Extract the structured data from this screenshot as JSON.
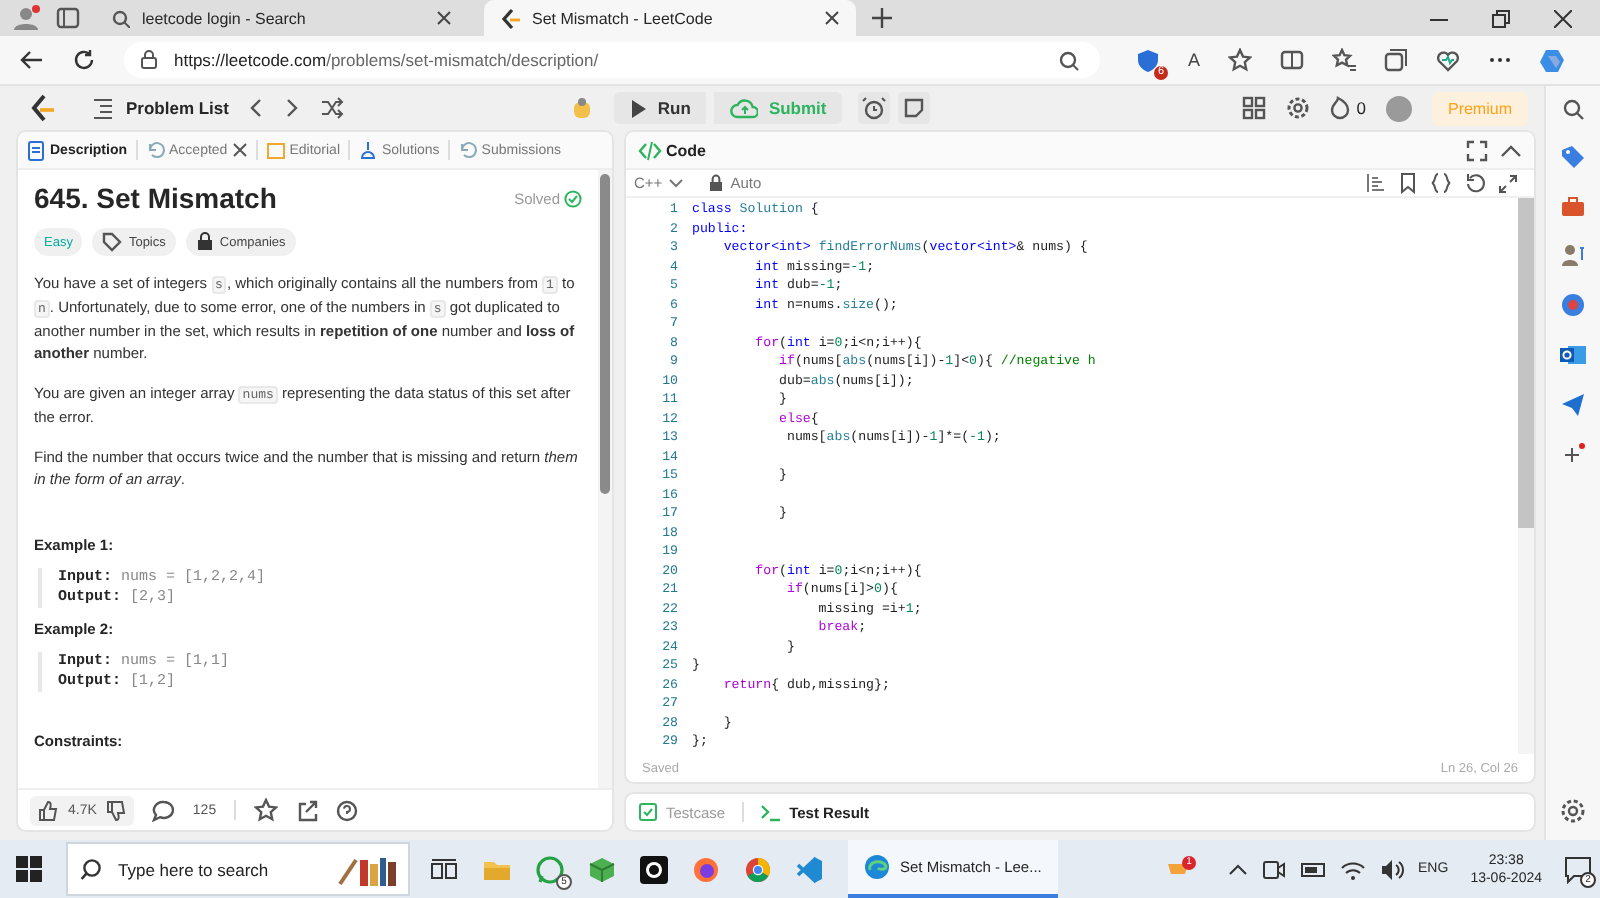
{
  "browser": {
    "tabs": [
      {
        "title": "leetcode login - Search",
        "selected": false
      },
      {
        "title": "Set Mismatch - LeetCode",
        "selected": true
      }
    ],
    "url_host": "https://leetcode.com",
    "url_path": "/problems/set-mismatch/description/",
    "extension_badge": "6",
    "read_aloud": "A"
  },
  "toolbar": {
    "problem_list": "Problem List",
    "run": "Run",
    "submit": "Submit",
    "streak": "0",
    "premium": "Premium"
  },
  "description_panel": {
    "tabs": [
      {
        "label": "Description",
        "selected": true,
        "closable": false
      },
      {
        "label": "Accepted",
        "selected": false,
        "closable": true
      },
      {
        "label": "Editorial",
        "selected": false,
        "closable": false
      },
      {
        "label": "Solutions",
        "selected": false,
        "closable": false
      },
      {
        "label": "Submissions",
        "selected": false,
        "closable": false
      }
    ],
    "title": "645. Set Mismatch",
    "status": "Solved",
    "tags": [
      {
        "label": "Easy",
        "kind": "difficulty"
      },
      {
        "label": "Topics",
        "kind": "topic"
      },
      {
        "label": "Companies",
        "kind": "company"
      }
    ],
    "paragraphs": [
      [
        {
          "kind": "text",
          "text": "You have a set of integers "
        },
        {
          "kind": "code",
          "text": "s"
        },
        {
          "kind": "text",
          "text": ", which originally contains all the numbers from "
        },
        {
          "kind": "code",
          "text": "1"
        },
        {
          "kind": "text",
          "text": " to "
        },
        {
          "kind": "code",
          "text": "n"
        },
        {
          "kind": "text",
          "text": ". Unfortunately, due to some error, one of the numbers in "
        },
        {
          "kind": "code",
          "text": "s"
        },
        {
          "kind": "text",
          "text": " got duplicated to another number in the set, which results in **repetition of one** number and **loss of another** number."
        }
      ],
      [
        {
          "kind": "text",
          "text": "You are given an integer array "
        },
        {
          "kind": "code",
          "text": "nums"
        },
        {
          "kind": "text",
          "text": " representing the data status of this set after the error."
        }
      ],
      [
        {
          "kind": "text",
          "text": "Find the number that occurs twice and the number that is missing and return *them in the form of an array*."
        }
      ]
    ],
    "examples": [
      {
        "heading": "Example 1:",
        "lines": [
          {
            "label": "Input:",
            "value": "nums = [1,2,2,4]"
          },
          {
            "label": "Output:",
            "value": "[2,3]"
          }
        ]
      },
      {
        "heading": "Example 2:",
        "lines": [
          {
            "label": "Input:",
            "value": "nums = [1,1]"
          },
          {
            "label": "Output:",
            "value": "[1,2]"
          }
        ]
      }
    ],
    "constraints_heading": "Constraints:",
    "likes": "4.7K",
    "comments": "125"
  },
  "code_panel": {
    "title": "Code",
    "language": "C++",
    "mode": "Auto",
    "lines": [
      {
        "number": "1",
        "tokens": [
          {
            "kind": "kw",
            "text": "class"
          },
          {
            "kind": "fn",
            "text": " Solution"
          },
          {
            "kind": "tx",
            "text": " {"
          }
        ]
      },
      {
        "number": "2",
        "tokens": [
          {
            "kind": "kw",
            "text": "public:"
          }
        ]
      },
      {
        "number": "3",
        "tokens": [
          {
            "kind": "kw",
            "text": "    vector<int>"
          },
          {
            "kind": "fn",
            "text": " findErrorNums"
          },
          {
            "kind": "tx",
            "text": "("
          },
          {
            "kind": "kw",
            "text": "vector<int>"
          },
          {
            "kind": "tx",
            "text": "& nums) {"
          }
        ]
      },
      {
        "number": "4",
        "tokens": [
          {
            "kind": "kw",
            "text": "        int"
          },
          {
            "kind": "tx",
            "text": " missing="
          },
          {
            "kind": "num",
            "text": "-1"
          },
          {
            "kind": "tx",
            "text": ";"
          }
        ]
      },
      {
        "number": "5",
        "tokens": [
          {
            "kind": "kw",
            "text": "        int"
          },
          {
            "kind": "tx",
            "text": " dub="
          },
          {
            "kind": "num",
            "text": "-1"
          },
          {
            "kind": "tx",
            "text": ";"
          }
        ]
      },
      {
        "number": "6",
        "tokens": [
          {
            "kind": "kw",
            "text": "        int"
          },
          {
            "kind": "tx",
            "text": " n=nums."
          },
          {
            "kind": "fn",
            "text": "size"
          },
          {
            "kind": "tx",
            "text": "();"
          }
        ]
      },
      {
        "number": "7"
      },
      {
        "number": "8",
        "tokens": [
          {
            "kind": "ctl",
            "text": "        for"
          },
          {
            "kind": "tx",
            "text": "("
          },
          {
            "kind": "kw",
            "text": "int"
          },
          {
            "kind": "tx",
            "text": " i="
          },
          {
            "kind": "num",
            "text": "0"
          },
          {
            "kind": "tx",
            "text": ";i<n;i++){"
          }
        ]
      },
      {
        "number": "9",
        "tokens": [
          {
            "kind": "ctl",
            "text": "           if"
          },
          {
            "kind": "tx",
            "text": "(nums["
          },
          {
            "kind": "fn",
            "text": "abs"
          },
          {
            "kind": "tx",
            "text": "(nums[i])-"
          },
          {
            "kind": "num",
            "text": "1"
          },
          {
            "kind": "tx",
            "text": "]<"
          },
          {
            "kind": "num",
            "text": "0"
          },
          {
            "kind": "tx",
            "text": "){ "
          },
          {
            "kind": "cm",
            "text": "//negative h"
          }
        ]
      },
      {
        "number": "10",
        "tokens": [
          {
            "kind": "tx",
            "text": "           dub="
          },
          {
            "kind": "fn",
            "text": "abs"
          },
          {
            "kind": "tx",
            "text": "(nums[i]);"
          }
        ]
      },
      {
        "number": "11",
        "tokens": [
          {
            "kind": "tx",
            "text": "           }"
          }
        ]
      },
      {
        "number": "12",
        "tokens": [
          {
            "kind": "ctl",
            "text": "           else"
          },
          {
            "kind": "tx",
            "text": "{"
          }
        ]
      },
      {
        "number": "13",
        "tokens": [
          {
            "kind": "tx",
            "text": "            nums["
          },
          {
            "kind": "fn",
            "text": "abs"
          },
          {
            "kind": "tx",
            "text": "(nums[i])-"
          },
          {
            "kind": "num",
            "text": "1"
          },
          {
            "kind": "tx",
            "text": "]*=("
          },
          {
            "kind": "num",
            "text": "-1"
          },
          {
            "kind": "tx",
            "text": ");"
          }
        ]
      },
      {
        "number": "14"
      },
      {
        "number": "15",
        "tokens": [
          {
            "kind": "tx",
            "text": "           }"
          }
        ]
      },
      {
        "number": "16"
      },
      {
        "number": "17",
        "tokens": [
          {
            "kind": "tx",
            "text": "           }"
          }
        ]
      },
      {
        "number": "18"
      },
      {
        "number": "19"
      },
      {
        "number": "20",
        "tokens": [
          {
            "kind": "ctl",
            "text": "        for"
          },
          {
            "kind": "tx",
            "text": "("
          },
          {
            "kind": "kw",
            "text": "int"
          },
          {
            "kind": "tx",
            "text": " i="
          },
          {
            "kind": "num",
            "text": "0"
          },
          {
            "kind": "tx",
            "text": ";i<n;i++){"
          }
        ]
      },
      {
        "number": "21",
        "tokens": [
          {
            "kind": "ctl",
            "text": "            if"
          },
          {
            "kind": "tx",
            "text": "(nums[i]>"
          },
          {
            "kind": "num",
            "text": "0"
          },
          {
            "kind": "tx",
            "text": "){"
          }
        ]
      },
      {
        "number": "22",
        "tokens": [
          {
            "kind": "tx",
            "text": "                missing =i+"
          },
          {
            "kind": "num",
            "text": "1"
          },
          {
            "kind": "tx",
            "text": ";"
          }
        ]
      },
      {
        "number": "23",
        "tokens": [
          {
            "kind": "ctl",
            "text": "                break"
          },
          {
            "kind": "tx",
            "text": ";"
          }
        ]
      },
      {
        "number": "24",
        "tokens": [
          {
            "kind": "tx",
            "text": "            }"
          }
        ]
      },
      {
        "number": "25",
        "tokens": [
          {
            "kind": "tx",
            "text": "}"
          }
        ]
      },
      {
        "number": "26",
        "tokens": [
          {
            "kind": "ctl",
            "text": "    return"
          },
          {
            "kind": "tx",
            "text": "{ dub,missing};"
          }
        ]
      },
      {
        "number": "27"
      },
      {
        "number": "28",
        "tokens": [
          {
            "kind": "tx",
            "text": "    }"
          }
        ]
      },
      {
        "number": "29",
        "tokens": [
          {
            "kind": "tx",
            "text": "};"
          }
        ]
      }
    ],
    "save_status": "Saved",
    "cursor_position": "Ln 26, Col 26",
    "bottom_tabs": [
      {
        "label": "Testcase",
        "selected": false
      },
      {
        "label": "Test Result",
        "selected": true
      }
    ]
  },
  "taskbar": {
    "search_placeholder": "Type here to search",
    "whatsapp_badge": "5",
    "active_app": "Set Mismatch - Lee...",
    "tray_badge": "1",
    "language": "ENG",
    "time": "23:38",
    "date": "13-06-2024",
    "notifications": "2"
  }
}
